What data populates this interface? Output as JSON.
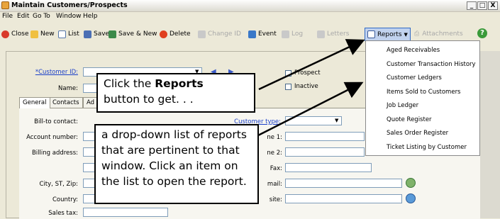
{
  "window": {
    "title": "Maintain Customers/Prospects",
    "min": "_",
    "max": "□",
    "close": "X"
  },
  "menubar": [
    "File",
    "Edit",
    "Go To",
    "Window",
    "Help"
  ],
  "toolbar": {
    "close": "Close",
    "new": "New",
    "list": "List",
    "save": "Save",
    "save_new": "Save & New",
    "delete": "Delete",
    "change_id": "Change ID",
    "event": "Event",
    "log": "Log",
    "letters": "Letters",
    "reports": "Reports",
    "attachments": "Attachments"
  },
  "form": {
    "customer_id": "*Customer ID:",
    "name": "Name:",
    "prospect": "Prospect",
    "inactive": "Inactive",
    "tabs": [
      "General",
      "Contacts",
      "Ad"
    ],
    "bill_to": "Bill-to contact:",
    "account_number": "Account number:",
    "billing_address": "Billing address:",
    "city_st_zip": "City, ST, Zip:",
    "country": "Country:",
    "sales_tax": "Sales tax:",
    "customer_type": "Customer type:",
    "phone1": "ne 1:",
    "phone2": "ne 2:",
    "fax": "Fax:",
    "email": "mail:",
    "website": "site:"
  },
  "reports_menu": [
    "Aged Receivables",
    "Customer Transaction History",
    "Customer Ledgers",
    "Items Sold to Customers",
    "Job Ledger",
    "Quote Register",
    "Sales Order Register",
    "Ticket Listing by Customer"
  ],
  "callout1": {
    "pre": "Click the ",
    "bold": "Reports",
    "post": "button to get. . ."
  },
  "callout2": [
    "a drop-down list of reports",
    "that are pertinent to that",
    "window. Click an item on",
    "the list to open the report."
  ]
}
